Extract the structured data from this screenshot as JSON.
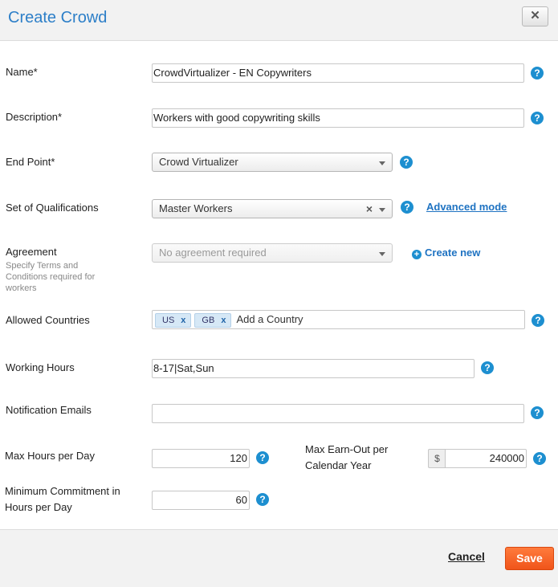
{
  "dialog": {
    "title": "Create Crowd",
    "close_label": "✕"
  },
  "form": {
    "name": {
      "label": "Name*",
      "value": "CrowdVirtualizer - EN Copywriters"
    },
    "description": {
      "label": "Description*",
      "value": "Workers with good copywriting skills"
    },
    "end_point": {
      "label": "End Point*",
      "value": "Crowd Virtualizer"
    },
    "qualifications": {
      "label": "Set of Qualifications",
      "value": "Master Workers",
      "clear_label": "×",
      "advanced_link": "Advanced mode"
    },
    "agreement": {
      "label": "Agreement",
      "sublabel": "Specify Terms and Conditions required for workers",
      "value": "No agreement required",
      "create_new": "Create new"
    },
    "countries": {
      "label": "Allowed Countries",
      "tags": [
        "US",
        "GB"
      ],
      "tag_remove": "x",
      "placeholder": "Add a Country"
    },
    "working_hours": {
      "label": "Working Hours",
      "value": "8-17|Sat,Sun"
    },
    "notification_emails": {
      "label": "Notification Emails",
      "value": ""
    },
    "max_hours": {
      "label": "Max Hours per Day",
      "value": "120"
    },
    "max_earn": {
      "label": "Max Earn-Out per Calendar Year",
      "currency": "$",
      "value": "240000"
    },
    "min_commitment": {
      "label": "Minimum Commitment in Hours per Day",
      "value": "60"
    }
  },
  "help_glyph": "?",
  "footer": {
    "cancel_label": "Cancel",
    "save_label": "Save"
  },
  "colors": {
    "accent": "#2d7fc8",
    "help_icon": "#1d8fd0",
    "save_button": "#f0541a"
  }
}
